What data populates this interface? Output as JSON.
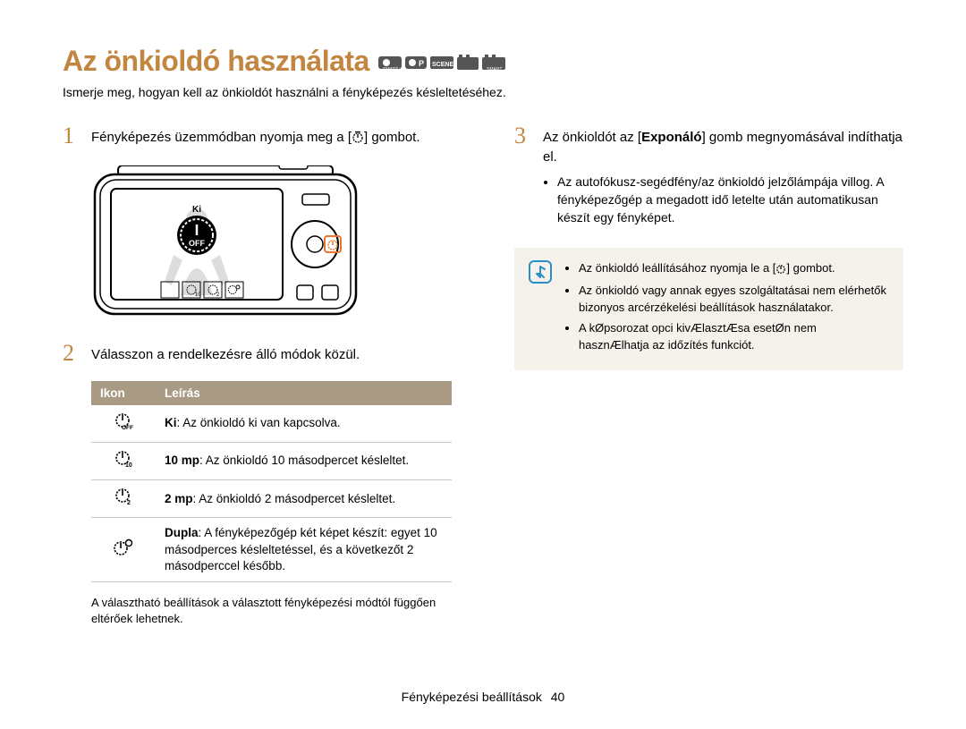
{
  "title": "Az önkioldó használata",
  "intro": "Ismerje meg, hogyan kell az önkioldót használni a fényképezés késleltetéséhez.",
  "step1_pre": "Fényképezés üzemmódban nyomja meg a [",
  "step1_post": "] gombot.",
  "step2": "Válasszon a rendelkezésre álló módok közül.",
  "step3_pre": "Az önkioldót az [",
  "step3_bold": "Exponáló",
  "step3_post": "] gomb megnyomásával indíthatja el.",
  "step3_b1": "Az autofókusz-segédfény/az önkioldó jelzőlámpája villog. A fényképezőgép a megadott idő letelte után automatikusan készít egy fényképet.",
  "note1_pre": "Az önkioldó leállításához nyomja le a [",
  "note1_post": "] gombot.",
  "note2": "Az önkioldó vagy annak egyes szolgáltatásai nem elérhetők bizonyos arcérzékelési beállítások használatakor.",
  "note3": "A kØpsorozat opci kivÆlasztÆsa esetØn nem hasznÆlhatja az időzítés funkciót.",
  "table": {
    "h1": "Ikon",
    "h2": "Leírás",
    "r1b": "Ki",
    "r1t": ": Az önkioldó ki van kapcsolva.",
    "r2b": "10 mp",
    "r2t": ": Az önkioldó 10 másodpercet késleltet.",
    "r3b": "2 mp",
    "r3t": ": Az önkioldó 2 másodpercet késleltet.",
    "r4b": "Dupla",
    "r4t": ": A fényképezőgép két képet készít: egyet 10 másodperces késleltetéssel, és a következőt 2 másodperccel később."
  },
  "footnote": "A választható beállítások a választott fényképezési módtól függően eltérőek lehetnek.",
  "camera_label": "Ki",
  "camera_off": "OFF",
  "footer_label": "Fényképezési beállítások",
  "footer_num": "40"
}
